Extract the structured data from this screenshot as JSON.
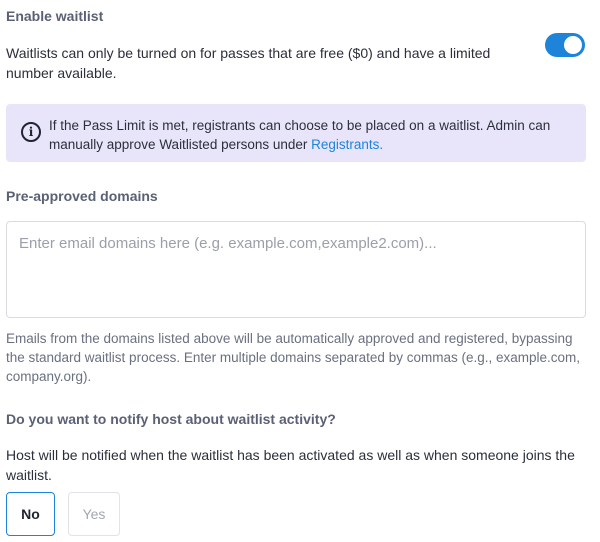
{
  "waitlist": {
    "title": "Enable waitlist",
    "description": "Waitlists can only be turned on for passes that are free ($0) and have a limited number available.",
    "toggle_on": true,
    "toggle_color": "#1d84d9",
    "info": {
      "icon": "info-circle-icon",
      "text": "If the Pass Limit is met, registrants can choose to be placed on a waitlist. Admin can manually approve Waitlisted persons under ",
      "link_label": "Registrants.",
      "background": "#e8e5fb"
    }
  },
  "domains": {
    "title": "Pre-approved domains",
    "placeholder": "Enter email domains here (e.g. example.com,example2.com)...",
    "value": "",
    "help": "Emails from the domains listed above will be automatically approved and registered, bypassing the standard waitlist process. Enter multiple domains separated by commas (e.g., example.com, company.org)."
  },
  "notify": {
    "title": "Do you want to notify host about waitlist activity?",
    "description": "Host will be notified when the waitlist has been activated as well as when someone joins the waitlist.",
    "options": [
      {
        "label": "No",
        "selected": true
      },
      {
        "label": "Yes",
        "selected": false
      }
    ]
  }
}
